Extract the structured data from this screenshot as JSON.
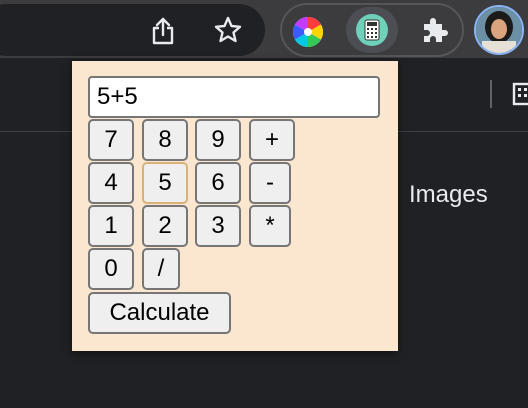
{
  "browser": {
    "toolbar_icons": [
      "share-icon",
      "star-icon"
    ],
    "extensions": [
      "color-wheel-extension-icon",
      "calculator-extension-icon",
      "puzzle-icon"
    ],
    "avatar": "profile-avatar"
  },
  "page": {
    "images_link": "Images"
  },
  "calculator": {
    "display_value": "5+5",
    "keys": {
      "k7": "7",
      "k8": "8",
      "k9": "9",
      "plus": "+",
      "k4": "4",
      "k5": "5",
      "k6": "6",
      "minus": "-",
      "k1": "1",
      "k2": "2",
      "k3": "3",
      "multiply": "*",
      "k0": "0",
      "divide": "/"
    },
    "calculate_label": "Calculate"
  }
}
